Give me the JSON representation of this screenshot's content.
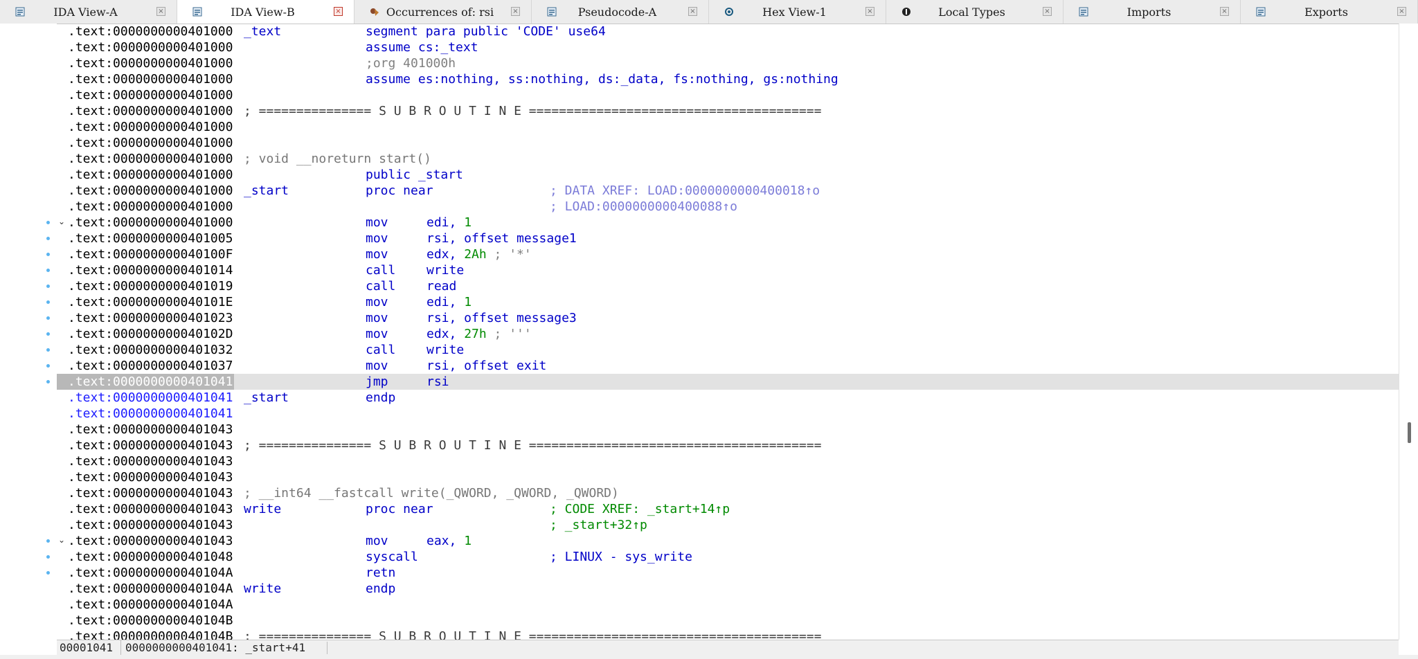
{
  "tabs": [
    {
      "label": "IDA View-A",
      "icon": "ida-view-icon",
      "active": false
    },
    {
      "label": "IDA View-B",
      "icon": "ida-view-icon",
      "active": true
    },
    {
      "label": "Occurrences of: rsi",
      "icon": "occurrences-icon",
      "active": false
    },
    {
      "label": "Pseudocode-A",
      "icon": "pseudocode-icon",
      "active": false
    },
    {
      "label": "Hex View-1",
      "icon": "hex-view-icon",
      "active": false
    },
    {
      "label": "Local Types",
      "icon": "local-types-icon",
      "active": false
    },
    {
      "label": "Imports",
      "icon": "imports-icon",
      "active": false
    },
    {
      "label": "Exports",
      "icon": "exports-icon",
      "active": false
    }
  ],
  "close_glyph": "×",
  "listing": [
    {
      "addr": ".text:0000000000401000",
      "label": "_text",
      "dir": "segment para public 'CODE' use64"
    },
    {
      "addr": ".text:0000000000401000",
      "dir": "assume cs:_text"
    },
    {
      "addr": ".text:0000000000401000",
      "dir_gray": ";org 401000h"
    },
    {
      "addr": ".text:0000000000401000",
      "dir": "assume es:nothing, ss:nothing, ds:_data, fs:nothing, gs:nothing"
    },
    {
      "addr": ".text:0000000000401000"
    },
    {
      "addr": ".text:0000000000401000",
      "sep": "; =============== S U B R O U T I N E ======================================="
    },
    {
      "addr": ".text:0000000000401000"
    },
    {
      "addr": ".text:0000000000401000"
    },
    {
      "addr": ".text:0000000000401000",
      "cmt": "; void __noreturn start()"
    },
    {
      "addr": ".text:0000000000401000",
      "dir": "public _start"
    },
    {
      "addr": ".text:0000000000401000",
      "label": "_start",
      "dir": "proc near",
      "xref": "; DATA XREF: LOAD:0000000000400018↑o"
    },
    {
      "addr": ".text:0000000000401000",
      "xref": "; LOAD:0000000000400088↑o"
    },
    {
      "addr": ".text:0000000000401000",
      "ins": "mov",
      "ops": "edi, ",
      "num": "1",
      "bp": true,
      "chev": true
    },
    {
      "addr": ".text:0000000000401005",
      "ins": "mov",
      "ops": "rsi, offset message1",
      "bp": true
    },
    {
      "addr": ".text:000000000040100F",
      "ins": "mov",
      "ops": "edx, ",
      "num": "2Ah",
      "tail": " ; '*'",
      "bp": true
    },
    {
      "addr": ".text:0000000000401014",
      "ins": "call",
      "ops": "write",
      "bp": true
    },
    {
      "addr": ".text:0000000000401019",
      "ins": "call",
      "ops": "read",
      "bp": true
    },
    {
      "addr": ".text:000000000040101E",
      "ins": "mov",
      "ops": "edi, ",
      "num": "1",
      "bp": true
    },
    {
      "addr": ".text:0000000000401023",
      "ins": "mov",
      "ops": "rsi, offset message3",
      "bp": true
    },
    {
      "addr": ".text:000000000040102D",
      "ins": "mov",
      "ops": "edx, ",
      "num": "27h",
      "tail": " ; '''",
      "bp": true
    },
    {
      "addr": ".text:0000000000401032",
      "ins": "call",
      "ops": "write",
      "bp": true
    },
    {
      "addr": ".text:0000000000401037",
      "ins": "mov",
      "ops": "rsi, offset exit",
      "bp": true
    },
    {
      "addr": ".text:0000000000401041",
      "ins": "jmp",
      "ops": "rsi",
      "bp": true,
      "selected": true
    },
    {
      "addr": ".text:0000000000401041",
      "label": "_start",
      "dir": "endp",
      "blue": true
    },
    {
      "addr": ".text:0000000000401041",
      "blue": true
    },
    {
      "addr": ".text:0000000000401043"
    },
    {
      "addr": ".text:0000000000401043",
      "sep": "; =============== S U B R O U T I N E ======================================="
    },
    {
      "addr": ".text:0000000000401043"
    },
    {
      "addr": ".text:0000000000401043"
    },
    {
      "addr": ".text:0000000000401043",
      "cmt": "; __int64 __fastcall write(_QWORD, _QWORD, _QWORD)"
    },
    {
      "addr": ".text:0000000000401043",
      "label": "write",
      "dir": "proc near",
      "green": "; CODE XREF: _start+14↑p"
    },
    {
      "addr": ".text:0000000000401043",
      "green": "; _start+32↑p"
    },
    {
      "addr": ".text:0000000000401043",
      "ins": "mov",
      "ops": "eax, ",
      "num": "1",
      "bp": true,
      "chev": true
    },
    {
      "addr": ".text:0000000000401048",
      "ins": "syscall",
      "syscmt": "; LINUX - sys_write",
      "bp": true
    },
    {
      "addr": ".text:000000000040104A",
      "ins": "retn",
      "bp": true
    },
    {
      "addr": ".text:000000000040104A",
      "label": "write",
      "dir": "endp"
    },
    {
      "addr": ".text:000000000040104A"
    },
    {
      "addr": ".text:000000000040104B"
    },
    {
      "addr": ".text:000000000040104B",
      "sep": "; =============== S U B R O U T I N E ======================================="
    }
  ],
  "status": {
    "offset": "00001041",
    "location": "0000000000401041: _start+41"
  },
  "colors": {
    "code_blue": "#0000c8",
    "number_green": "#008a00",
    "xref_purple": "#7b7bd8",
    "selection": "#b8b8b8",
    "highlight_row": "#e2e2e2",
    "breakpoint_dot": "#5ab4f0"
  }
}
